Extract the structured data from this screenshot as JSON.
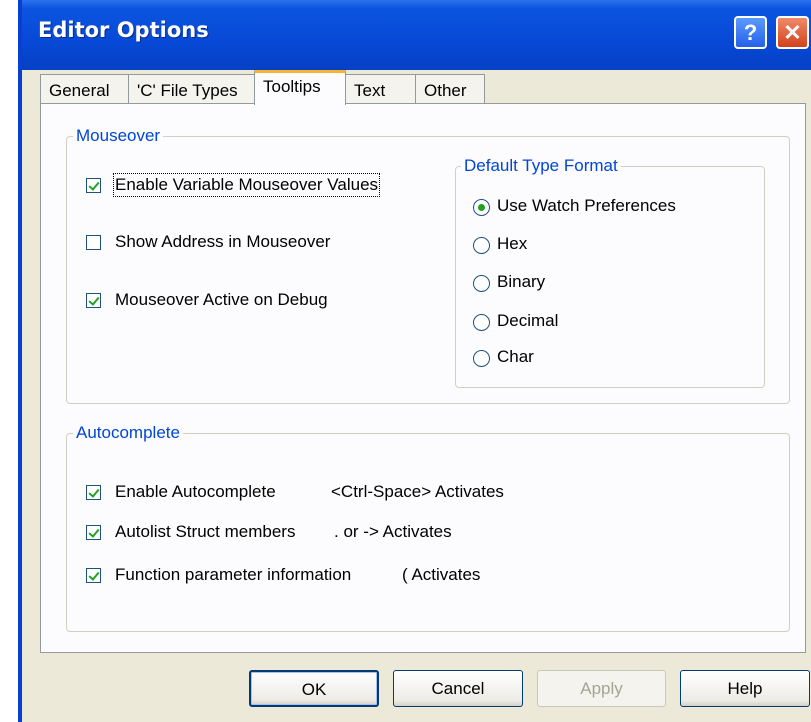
{
  "window": {
    "title": "Editor Options"
  },
  "titlebar": {
    "help_glyph": "?",
    "close_glyph": "✕"
  },
  "tabs": [
    {
      "label": "General"
    },
    {
      "label": "'C' File Types"
    },
    {
      "label": "Tooltips",
      "active": true
    },
    {
      "label": "Text"
    },
    {
      "label": "Other"
    }
  ],
  "mouseover": {
    "legend": "Mouseover",
    "items": [
      {
        "label": "Enable Variable Mouseover Values",
        "checked": true
      },
      {
        "label": "Show Address in Mouseover",
        "checked": false
      },
      {
        "label": "Mouseover Active on Debug",
        "checked": true
      }
    ]
  },
  "type_format": {
    "legend": "Default Type Format",
    "options": [
      {
        "label": "Use Watch Preferences",
        "selected": true
      },
      {
        "label": "Hex",
        "selected": false
      },
      {
        "label": "Binary",
        "selected": false
      },
      {
        "label": "Decimal",
        "selected": false
      },
      {
        "label": "Char",
        "selected": false
      }
    ]
  },
  "autocomplete": {
    "legend": "Autocomplete",
    "items": [
      {
        "label": "Enable Autocomplete",
        "hint": "<Ctrl-Space> Activates",
        "checked": true
      },
      {
        "label": "Autolist Struct members",
        "hint": ". or -> Activates",
        "checked": true
      },
      {
        "label": "Function parameter information",
        "hint": "( Activates",
        "checked": true
      }
    ]
  },
  "buttons": {
    "ok": "OK",
    "cancel": "Cancel",
    "apply": "Apply",
    "help": "Help"
  },
  "colors": {
    "accent": "#0046d5",
    "check": "#21a121",
    "titlebar": "#0749d6"
  }
}
